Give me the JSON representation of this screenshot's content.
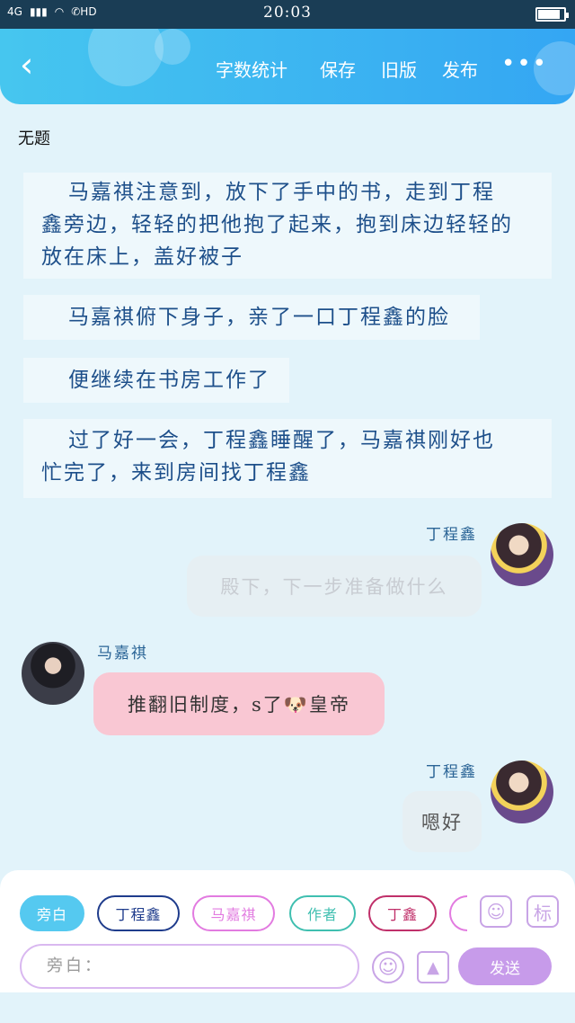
{
  "status": {
    "network": "4G",
    "hd": "HD",
    "time": "20:03",
    "battery_level": 0.85
  },
  "header": {
    "back_icon": "chevron-left-icon",
    "actions": [
      "字数统计",
      "保存",
      "旧版",
      "发布"
    ],
    "more_icon": "more-dots-icon"
  },
  "doc": {
    "title": "无题"
  },
  "paragraphs": [
    [
      "马嘉祺注意到，放下了手中的书，走到丁程",
      "鑫旁边，轻轻的把他抱了起来，抱到床边轻轻的",
      "放在床上，盖好被子"
    ],
    [
      "马嘉祺俯下身子，亲了一口丁程鑫的脸"
    ],
    [
      "便继续在书房工作了"
    ],
    [
      "过了好一会，丁程鑫睡醒了，马嘉祺刚好也",
      "忙完了，来到房间找丁程鑫"
    ]
  ],
  "messages": [
    {
      "sender": "丁程鑫",
      "text": "殿下，下一步准备做什么",
      "side": "right"
    },
    {
      "sender": "马嘉祺",
      "text": "推翻旧制度，s了🐶皇帝",
      "side": "left"
    },
    {
      "sender": "丁程鑫",
      "text": "嗯好",
      "side": "right"
    }
  ],
  "bottom": {
    "chips": [
      "旁白",
      "丁程鑫",
      "马嘉祺",
      "作者",
      "丁鑫",
      ""
    ],
    "role_icon": "person-card-icon",
    "tag_label": "标",
    "input_placeholder": "旁白：",
    "emoji_icon": "smiley-icon",
    "image_icon": "image-icon",
    "send_label": "发送"
  },
  "colors": {
    "accent": "#34a6f3",
    "narration_text": "#1d4f8a",
    "pink_bubble": "#f9c7d3",
    "send_button": "#c79bea"
  }
}
